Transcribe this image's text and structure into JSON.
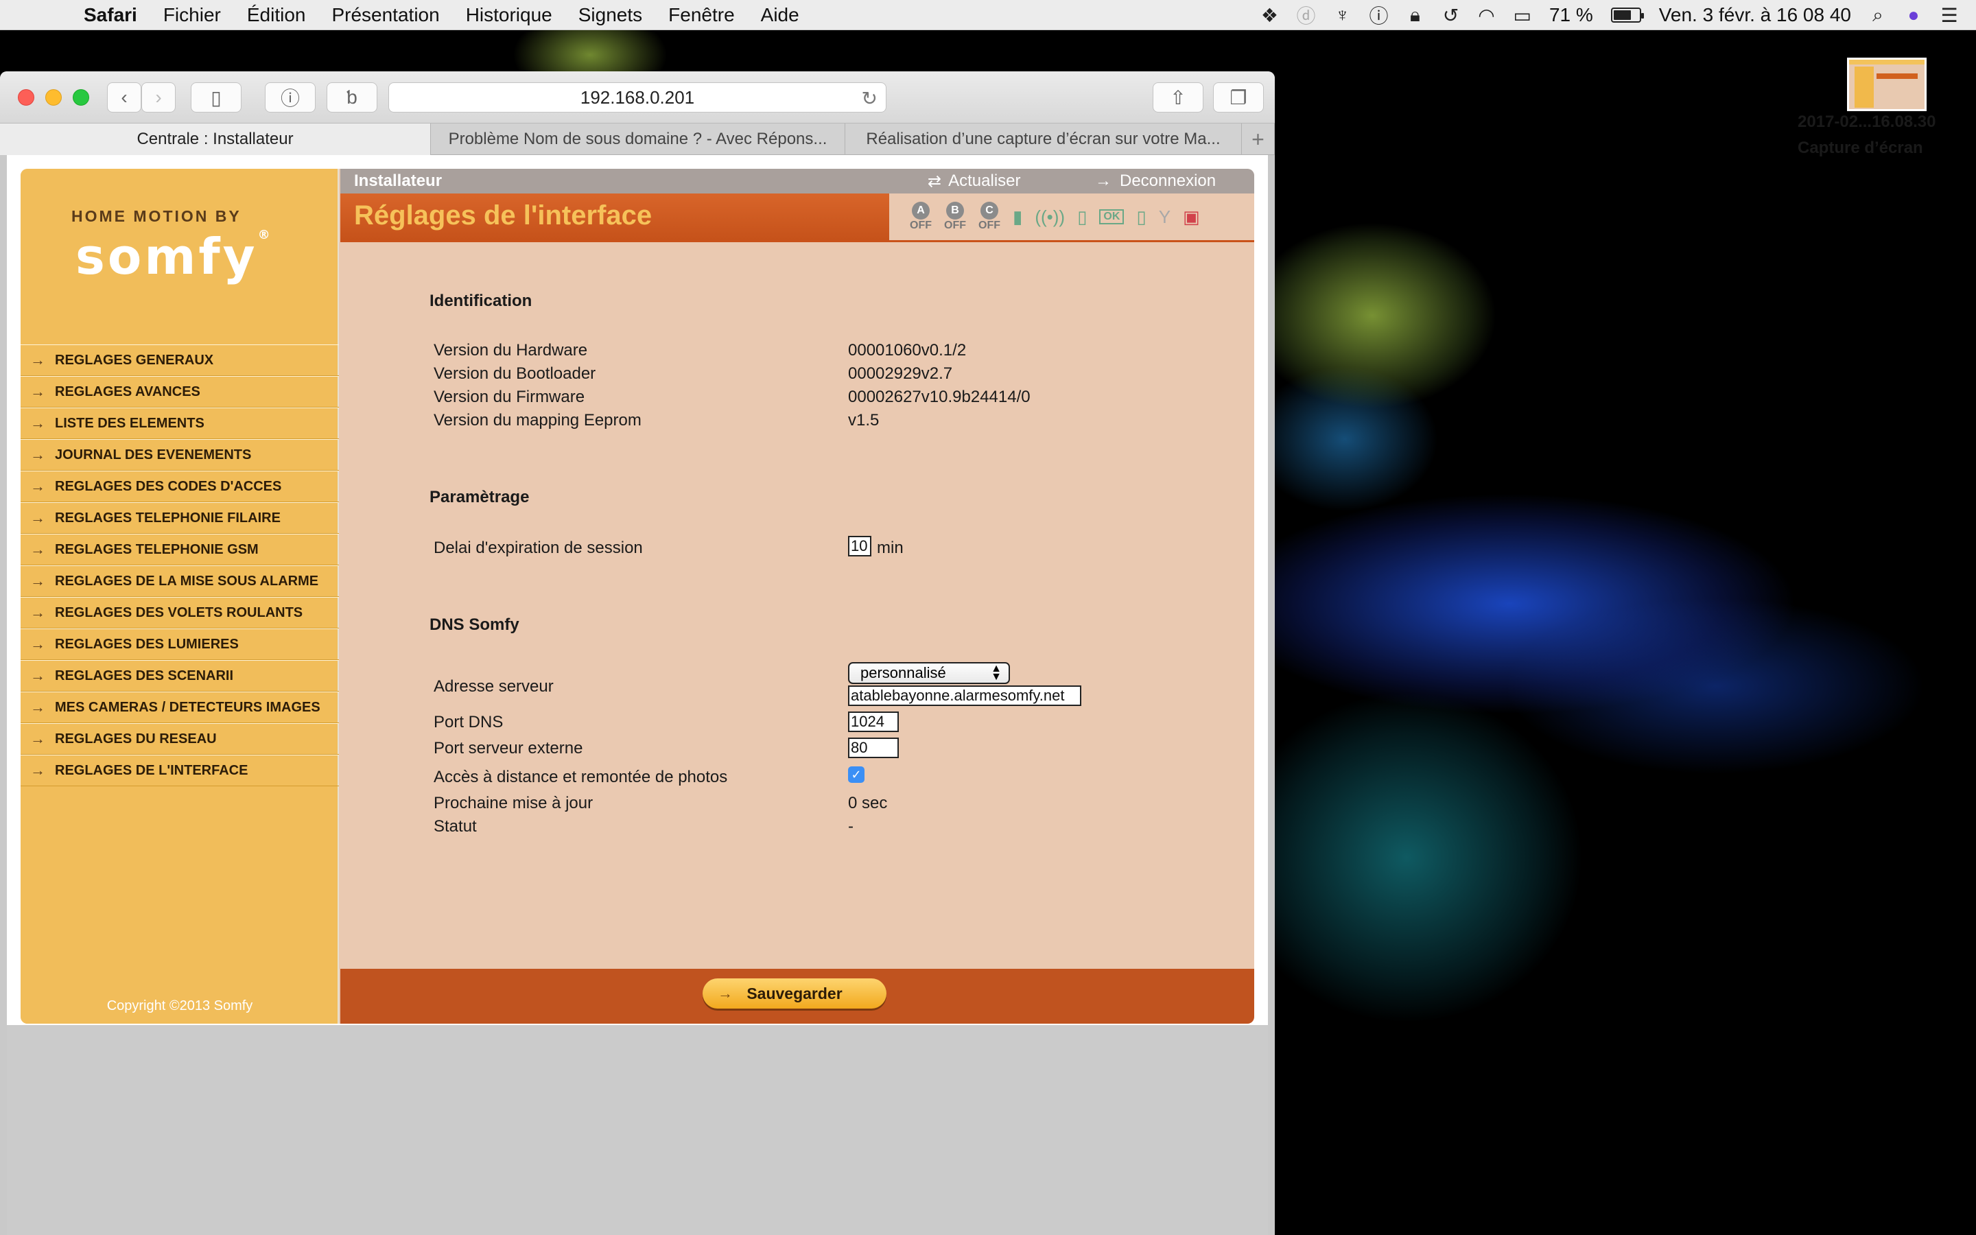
{
  "menubar": {
    "app": "Safari",
    "items": [
      "Fichier",
      "Édition",
      "Présentation",
      "Historique",
      "Signets",
      "Fenêtre",
      "Aide"
    ],
    "battery": "71 %",
    "battery_level": 0.71,
    "clock": "Ven. 3 févr. à  16 08 40"
  },
  "desktop": {
    "icon_label_1": "Capture d’écran",
    "icon_label_2": "2017-02...16.08.30"
  },
  "browser": {
    "url": "192.168.0.201",
    "tabs": [
      "Centrale  : Installateur",
      "Problème Nom de sous domaine ? - Avec Répons...",
      "Réalisation d’une capture d’écran sur votre Ma..."
    ],
    "new_tab": "+"
  },
  "sidebar": {
    "brand_top": "HOME MOTION BY",
    "brand": "somfy",
    "brand_mark": "®",
    "items": [
      "REGLAGES GENERAUX",
      "REGLAGES AVANCES",
      "LISTE DES ELEMENTS",
      "JOURNAL DES EVENEMENTS",
      "REGLAGES DES CODES D'ACCES",
      "REGLAGES TELEPHONIE FILAIRE",
      "REGLAGES TELEPHONIE GSM",
      "REGLAGES DE LA MISE SOUS ALARME",
      "REGLAGES DES VOLETS ROULANTS",
      "REGLAGES DES LUMIERES",
      "REGLAGES DES SCENARII",
      "MES CAMERAS / DETECTEURS IMAGES",
      "REGLAGES DU RESEAU",
      "REGLAGES DE L'INTERFACE"
    ],
    "copyright": "Copyright ©2013 Somfy"
  },
  "header": {
    "role": "Installateur",
    "refresh": "Actualiser",
    "logout": "Deconnexion",
    "title": "Réglages de l'interface",
    "zones": [
      {
        "letter": "A",
        "state": "OFF"
      },
      {
        "letter": "B",
        "state": "OFF"
      },
      {
        "letter": "C",
        "state": "OFF"
      }
    ],
    "ok_label": "OK"
  },
  "identification": {
    "title": "Identification",
    "rows": [
      {
        "label": "Version du Hardware",
        "value": "00001060v0.1/2"
      },
      {
        "label": "Version du Bootloader",
        "value": "00002929v2.7"
      },
      {
        "label": "Version du Firmware",
        "value": "00002627v10.9b24414/0"
      },
      {
        "label": "Version du mapping Eeprom",
        "value": "v1.5"
      }
    ]
  },
  "parametrage": {
    "title": "Paramètrage",
    "session_label": "Delai d'expiration de session",
    "session_value": "10",
    "session_unit": "min"
  },
  "dns": {
    "title": "DNS Somfy",
    "server_label": "Adresse serveur",
    "server_mode": "personnalisé",
    "server_value": "atablebayonne.alarmesomfy.net",
    "port_dns_label": "Port DNS",
    "port_dns_value": "1024",
    "port_ext_label": "Port serveur externe",
    "port_ext_value": "80",
    "remote_label": "Accès à distance et remontée de photos",
    "remote_checked": true,
    "next_update_label": "Prochaine mise à jour",
    "next_update_value": "0 sec",
    "status_label": "Statut",
    "status_value": "-"
  },
  "footer": {
    "save": "Sauvegarder"
  }
}
